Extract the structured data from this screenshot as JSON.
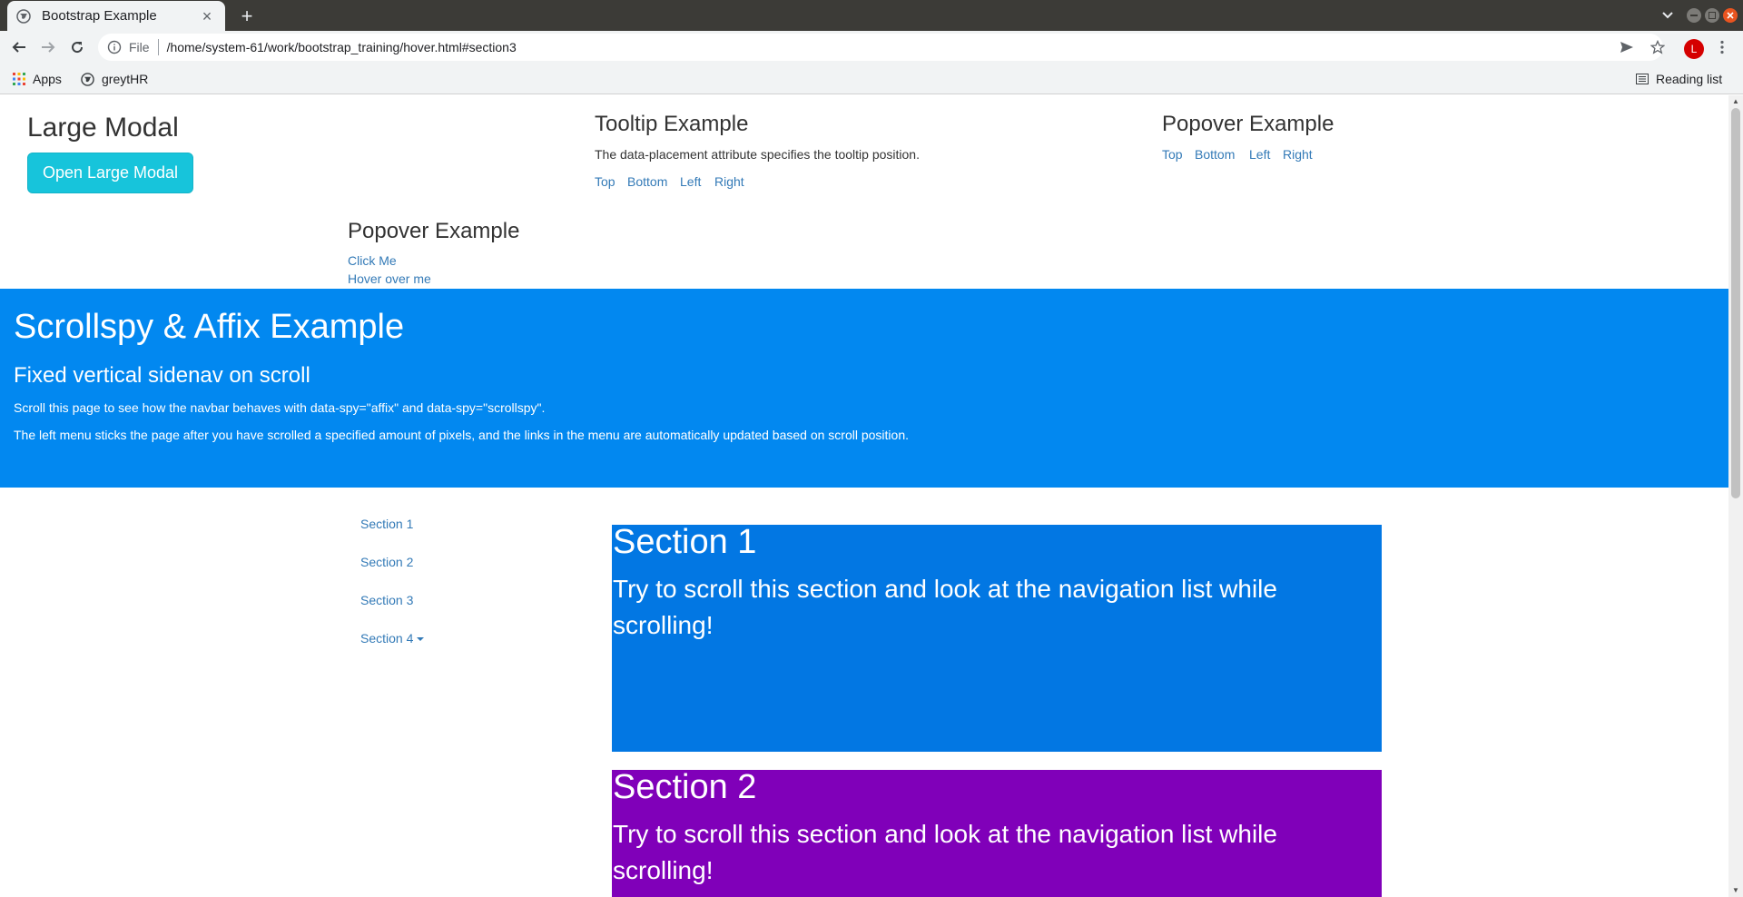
{
  "browser": {
    "tab_title": "Bootstrap Example",
    "tab_close": "×",
    "new_tab": "+",
    "url_scheme": "File",
    "url": "/home/system-61/work/bootstrap_training/hover.html#section3",
    "avatar_letter": "L",
    "bookmarks": [
      {
        "label": "Apps",
        "icon": "apps-grid-icon"
      },
      {
        "label": "greytHR",
        "icon": "globe-icon"
      }
    ],
    "reading_list": "Reading list"
  },
  "modal_demo": {
    "title": "Large Modal",
    "button": "Open Large Modal"
  },
  "tooltip_demo": {
    "title": "Tooltip Example",
    "description": "The data-placement attribute specifies the tooltip position.",
    "links": [
      "Top",
      "Bottom",
      "Left",
      "Right"
    ]
  },
  "popover_demo": {
    "title": "Popover Example",
    "links": [
      "Top",
      "Bottom",
      "Left",
      "Right"
    ]
  },
  "popover_demo2": {
    "title": "Popover Example",
    "click_link": "Click Me",
    "hover_link": "Hover over me"
  },
  "jumbotron": {
    "title": "Scrollspy & Affix Example",
    "subtitle": "Fixed vertical sidenav on scroll",
    "p1": "Scroll this page to see how the navbar behaves with data-spy=\"affix\" and data-spy=\"scrollspy\".",
    "p2": "The left menu sticks the page after you have scrolled a specified amount of pixels, and the links in the menu are automatically updated based on scroll position.",
    "color": "#0288f0"
  },
  "sidenav": {
    "items": [
      "Section 1",
      "Section 2",
      "Section 3",
      "Section 4"
    ]
  },
  "sections": [
    {
      "title": "Section 1",
      "text": "Try to scroll this section and look at the navigation list while scrolling!",
      "color": "#0277e3"
    },
    {
      "title": "Section 2",
      "text": "Try to scroll this section and look at the navigation list while scrolling!",
      "color": "#8000b9"
    }
  ]
}
